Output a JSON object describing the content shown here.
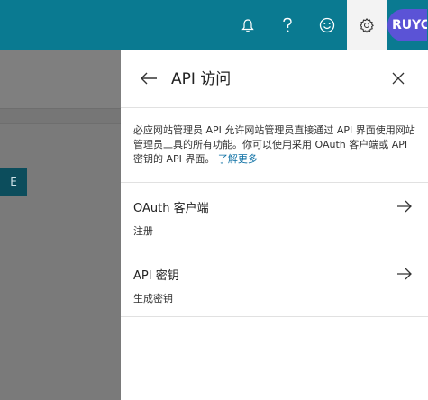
{
  "colors": {
    "topbar": "#0a7a91",
    "avatar": "#5b53d6",
    "link": "#0a6ea3"
  },
  "topbar": {
    "icons": [
      "bell-icon",
      "help-icon",
      "smiley-icon",
      "gear-icon"
    ],
    "avatar_initials": "RUYC"
  },
  "background": {
    "button_label": "E"
  },
  "panel": {
    "title": "API 访问",
    "back_icon": "arrow-left-icon",
    "close_icon": "close-icon",
    "description": "必应网站管理员 API 允许网站管理员直接通过 API 界面使用网站管理员工具的所有功能。你可以使用采用 OAuth 客户端或 API 密钥的 API 界面。",
    "learn_more": "了解更多",
    "items": [
      {
        "title": "OAuth 客户端",
        "subtitle": "注册",
        "icon": "arrow-right-icon"
      },
      {
        "title": "API 密钥",
        "subtitle": "生成密钥",
        "icon": "arrow-right-icon"
      }
    ]
  }
}
